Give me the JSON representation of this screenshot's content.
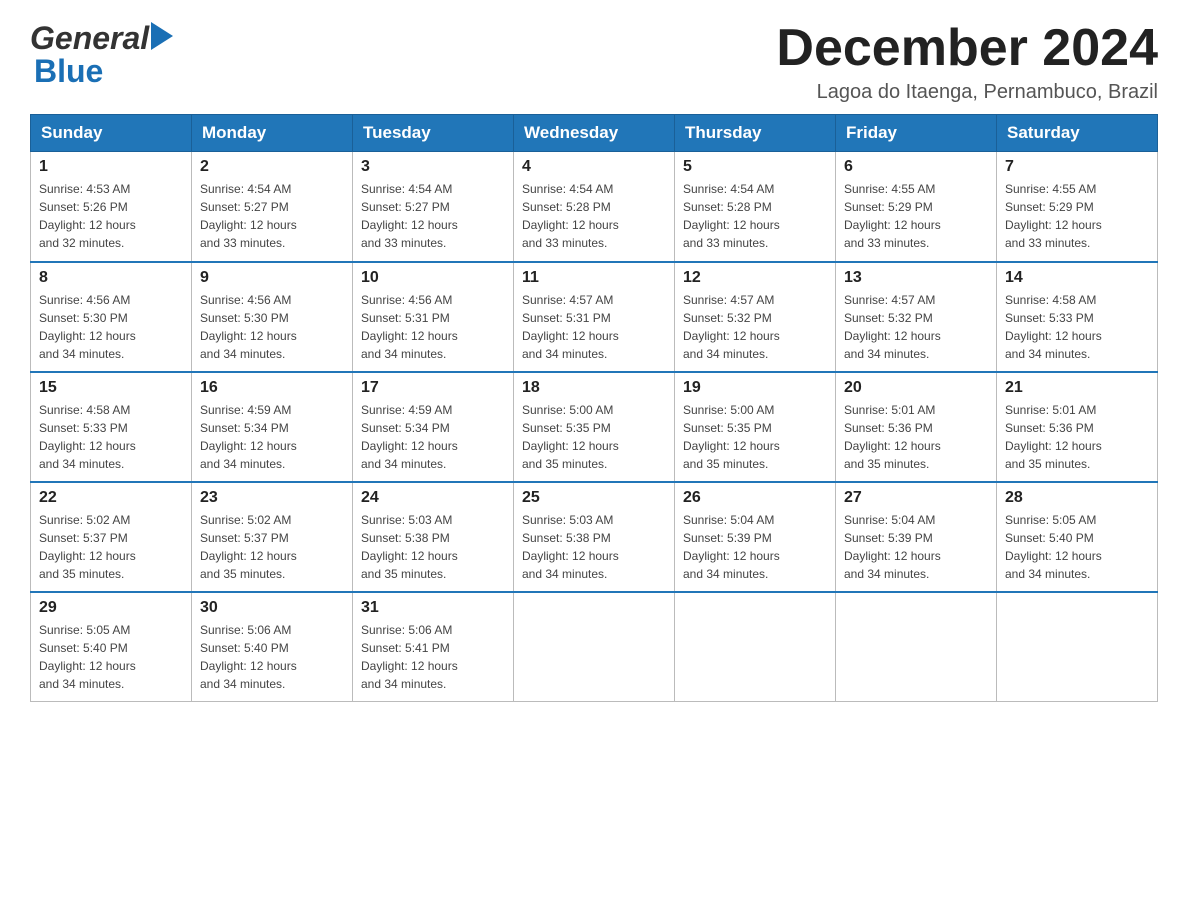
{
  "header": {
    "logo_general": "General",
    "logo_blue": "Blue",
    "month_title": "December 2024",
    "location": "Lagoa do Itaenga, Pernambuco, Brazil"
  },
  "weekdays": [
    "Sunday",
    "Monday",
    "Tuesday",
    "Wednesday",
    "Thursday",
    "Friday",
    "Saturday"
  ],
  "weeks": [
    [
      {
        "day": "1",
        "sunrise": "4:53 AM",
        "sunset": "5:26 PM",
        "daylight": "12 hours and 32 minutes."
      },
      {
        "day": "2",
        "sunrise": "4:54 AM",
        "sunset": "5:27 PM",
        "daylight": "12 hours and 33 minutes."
      },
      {
        "day": "3",
        "sunrise": "4:54 AM",
        "sunset": "5:27 PM",
        "daylight": "12 hours and 33 minutes."
      },
      {
        "day": "4",
        "sunrise": "4:54 AM",
        "sunset": "5:28 PM",
        "daylight": "12 hours and 33 minutes."
      },
      {
        "day": "5",
        "sunrise": "4:54 AM",
        "sunset": "5:28 PM",
        "daylight": "12 hours and 33 minutes."
      },
      {
        "day": "6",
        "sunrise": "4:55 AM",
        "sunset": "5:29 PM",
        "daylight": "12 hours and 33 minutes."
      },
      {
        "day": "7",
        "sunrise": "4:55 AM",
        "sunset": "5:29 PM",
        "daylight": "12 hours and 33 minutes."
      }
    ],
    [
      {
        "day": "8",
        "sunrise": "4:56 AM",
        "sunset": "5:30 PM",
        "daylight": "12 hours and 34 minutes."
      },
      {
        "day": "9",
        "sunrise": "4:56 AM",
        "sunset": "5:30 PM",
        "daylight": "12 hours and 34 minutes."
      },
      {
        "day": "10",
        "sunrise": "4:56 AM",
        "sunset": "5:31 PM",
        "daylight": "12 hours and 34 minutes."
      },
      {
        "day": "11",
        "sunrise": "4:57 AM",
        "sunset": "5:31 PM",
        "daylight": "12 hours and 34 minutes."
      },
      {
        "day": "12",
        "sunrise": "4:57 AM",
        "sunset": "5:32 PM",
        "daylight": "12 hours and 34 minutes."
      },
      {
        "day": "13",
        "sunrise": "4:57 AM",
        "sunset": "5:32 PM",
        "daylight": "12 hours and 34 minutes."
      },
      {
        "day": "14",
        "sunrise": "4:58 AM",
        "sunset": "5:33 PM",
        "daylight": "12 hours and 34 minutes."
      }
    ],
    [
      {
        "day": "15",
        "sunrise": "4:58 AM",
        "sunset": "5:33 PM",
        "daylight": "12 hours and 34 minutes."
      },
      {
        "day": "16",
        "sunrise": "4:59 AM",
        "sunset": "5:34 PM",
        "daylight": "12 hours and 34 minutes."
      },
      {
        "day": "17",
        "sunrise": "4:59 AM",
        "sunset": "5:34 PM",
        "daylight": "12 hours and 34 minutes."
      },
      {
        "day": "18",
        "sunrise": "5:00 AM",
        "sunset": "5:35 PM",
        "daylight": "12 hours and 35 minutes."
      },
      {
        "day": "19",
        "sunrise": "5:00 AM",
        "sunset": "5:35 PM",
        "daylight": "12 hours and 35 minutes."
      },
      {
        "day": "20",
        "sunrise": "5:01 AM",
        "sunset": "5:36 PM",
        "daylight": "12 hours and 35 minutes."
      },
      {
        "day": "21",
        "sunrise": "5:01 AM",
        "sunset": "5:36 PM",
        "daylight": "12 hours and 35 minutes."
      }
    ],
    [
      {
        "day": "22",
        "sunrise": "5:02 AM",
        "sunset": "5:37 PM",
        "daylight": "12 hours and 35 minutes."
      },
      {
        "day": "23",
        "sunrise": "5:02 AM",
        "sunset": "5:37 PM",
        "daylight": "12 hours and 35 minutes."
      },
      {
        "day": "24",
        "sunrise": "5:03 AM",
        "sunset": "5:38 PM",
        "daylight": "12 hours and 35 minutes."
      },
      {
        "day": "25",
        "sunrise": "5:03 AM",
        "sunset": "5:38 PM",
        "daylight": "12 hours and 34 minutes."
      },
      {
        "day": "26",
        "sunrise": "5:04 AM",
        "sunset": "5:39 PM",
        "daylight": "12 hours and 34 minutes."
      },
      {
        "day": "27",
        "sunrise": "5:04 AM",
        "sunset": "5:39 PM",
        "daylight": "12 hours and 34 minutes."
      },
      {
        "day": "28",
        "sunrise": "5:05 AM",
        "sunset": "5:40 PM",
        "daylight": "12 hours and 34 minutes."
      }
    ],
    [
      {
        "day": "29",
        "sunrise": "5:05 AM",
        "sunset": "5:40 PM",
        "daylight": "12 hours and 34 minutes."
      },
      {
        "day": "30",
        "sunrise": "5:06 AM",
        "sunset": "5:40 PM",
        "daylight": "12 hours and 34 minutes."
      },
      {
        "day": "31",
        "sunrise": "5:06 AM",
        "sunset": "5:41 PM",
        "daylight": "12 hours and 34 minutes."
      },
      null,
      null,
      null,
      null
    ]
  ]
}
